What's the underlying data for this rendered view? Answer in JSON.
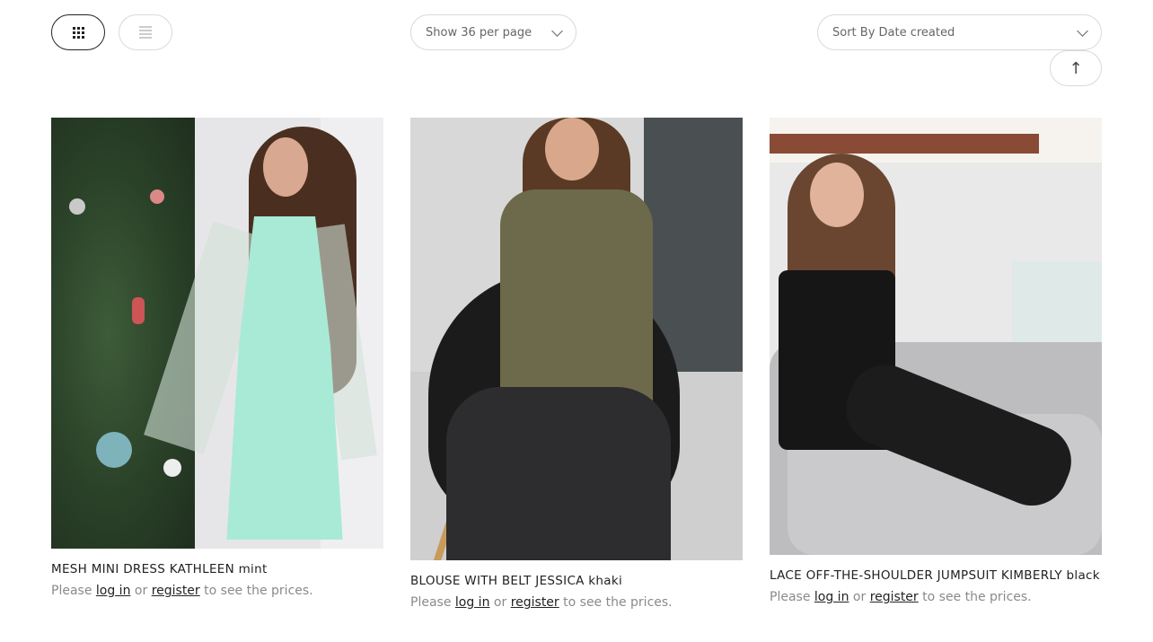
{
  "toolbar": {
    "view_grid_label": "Grid view",
    "view_list_label": "List view",
    "per_page_label": "Show 36 per page",
    "sort_label": "Sort By Date created",
    "scroll_top_glyph": "↑"
  },
  "products": [
    {
      "name": "MESH MINI DRESS KATHLEEN mint",
      "note_prefix": "Please",
      "login": "log in",
      "or": "or",
      "register": "register",
      "note_suffix": "to see the prices."
    },
    {
      "name": "BLOUSE WITH BELT JESSICA khaki",
      "note_prefix": "Please",
      "login": "log in",
      "or": "or",
      "register": "register",
      "note_suffix": "to see the prices."
    },
    {
      "name": "LACE OFF-THE-SHOULDER JUMPSUIT KIMBERLY black",
      "note_prefix": "Please",
      "login": "log in",
      "or": "or",
      "register": "register",
      "note_suffix": "to see the prices."
    }
  ],
  "colors": {
    "accent_border": "#222222",
    "muted_border": "#d9d9d9",
    "muted_text": "#8a8a8a"
  },
  "icons": {
    "grid_view": "grid-icon",
    "list_view": "list-icon",
    "chevron": "chevron-down-icon",
    "scroll_top": "arrow-up-icon"
  }
}
